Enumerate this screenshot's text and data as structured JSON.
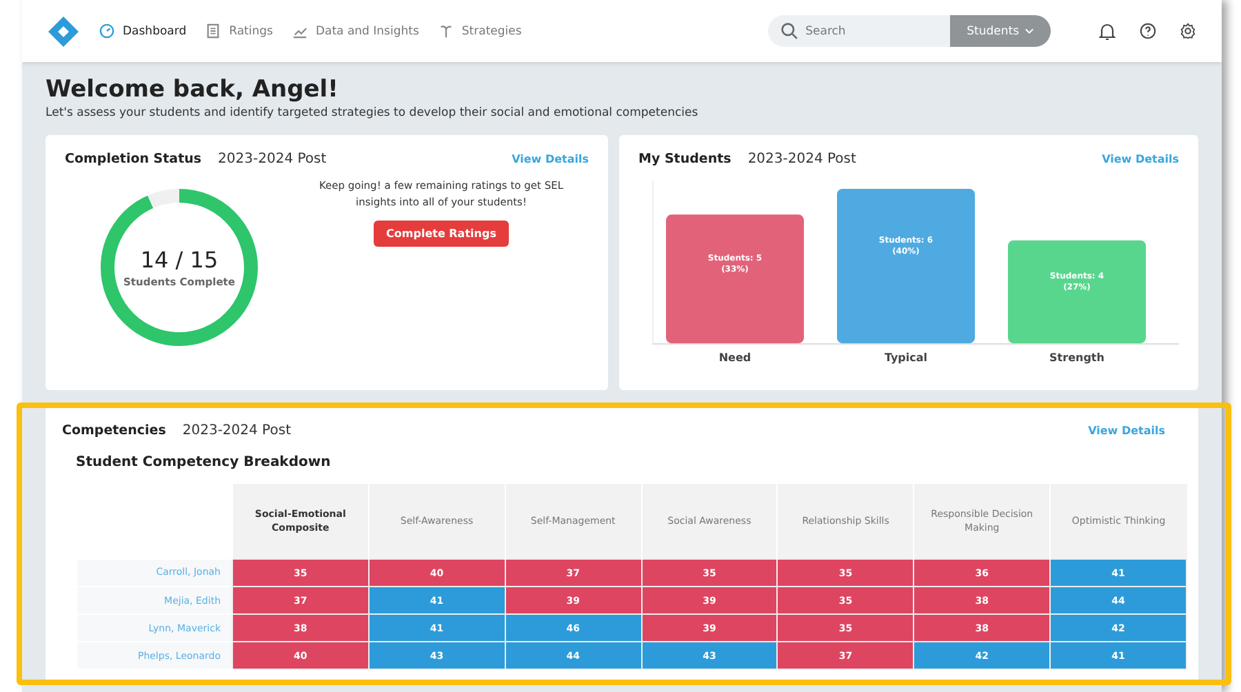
{
  "nav": {
    "items": [
      {
        "label": "Dashboard",
        "selected": true
      },
      {
        "label": "Ratings",
        "selected": false
      },
      {
        "label": "Data and Insights",
        "selected": false
      },
      {
        "label": "Strategies",
        "selected": false
      }
    ],
    "search": {
      "placeholder": "Search"
    },
    "scope": "Students"
  },
  "welcome": {
    "title": "Welcome back, Angel!",
    "subtitle": "Let's assess your students and identify targeted strategies to develop their social and emotional competencies"
  },
  "completion": {
    "title": "Completion Status",
    "period": "2023-2024 Post",
    "link": "View Details",
    "count": "14 / 15",
    "caption": "Students Complete",
    "message": "Keep going! a few remaining ratings to get SEL insights into all of your students!",
    "button": "Complete Ratings"
  },
  "my_students": {
    "title": "My Students",
    "period": "2023-2024 Post",
    "link": "View Details",
    "chart_data": {
      "type": "bar",
      "categories": [
        "Need",
        "Typical",
        "Strength"
      ],
      "values": [
        5,
        6,
        4
      ],
      "colors": [
        "#e2627a",
        "#4eaae0",
        "#58d68d"
      ],
      "value_labels": [
        "Students: 5 (33%)",
        "Students: 6 (40%)",
        "Students: 4 (27%)"
      ]
    }
  },
  "competencies": {
    "title": "Competencies",
    "period": "2023-2024 Post",
    "link": "View Details",
    "subtitle": "Student Competency Breakdown",
    "columns": [
      "Social-Emotional Composite",
      "Self-Awareness",
      "Self-Management",
      "Social Awareness",
      "Relationship Skills",
      "Responsible Decision Making",
      "Optimistic Thinking"
    ],
    "rows": [
      {
        "name": "Carroll, Jonah",
        "cells": [
          {
            "value": "35",
            "color": "#de4561"
          },
          {
            "value": "40",
            "color": "#de4561"
          },
          {
            "value": "37",
            "color": "#de4561"
          },
          {
            "value": "35",
            "color": "#de4561"
          },
          {
            "value": "35",
            "color": "#de4561"
          },
          {
            "value": "36",
            "color": "#de4561"
          },
          {
            "value": "41",
            "color": "#2d9bd9"
          }
        ]
      },
      {
        "name": "Mejia, Edith",
        "cells": [
          {
            "value": "37",
            "color": "#de4561"
          },
          {
            "value": "41",
            "color": "#2d9bd9"
          },
          {
            "value": "39",
            "color": "#de4561"
          },
          {
            "value": "39",
            "color": "#de4561"
          },
          {
            "value": "35",
            "color": "#de4561"
          },
          {
            "value": "38",
            "color": "#de4561"
          },
          {
            "value": "44",
            "color": "#2d9bd9"
          }
        ]
      },
      {
        "name": "Lynn, Maverick",
        "cells": [
          {
            "value": "38",
            "color": "#de4561"
          },
          {
            "value": "41",
            "color": "#2d9bd9"
          },
          {
            "value": "46",
            "color": "#2d9bd9"
          },
          {
            "value": "39",
            "color": "#de4561"
          },
          {
            "value": "35",
            "color": "#de4561"
          },
          {
            "value": "38",
            "color": "#de4561"
          },
          {
            "value": "42",
            "color": "#2d9bd9"
          }
        ]
      },
      {
        "name": "Phelps, Leonardo",
        "cells": [
          {
            "value": "40",
            "color": "#de4561"
          },
          {
            "value": "43",
            "color": "#2d9bd9"
          },
          {
            "value": "44",
            "color": "#2d9bd9"
          },
          {
            "value": "43",
            "color": "#2d9bd9"
          },
          {
            "value": "37",
            "color": "#de4561"
          },
          {
            "value": "42",
            "color": "#2d9bd9"
          },
          {
            "value": "41",
            "color": "#2d9bd9"
          }
        ]
      }
    ]
  }
}
